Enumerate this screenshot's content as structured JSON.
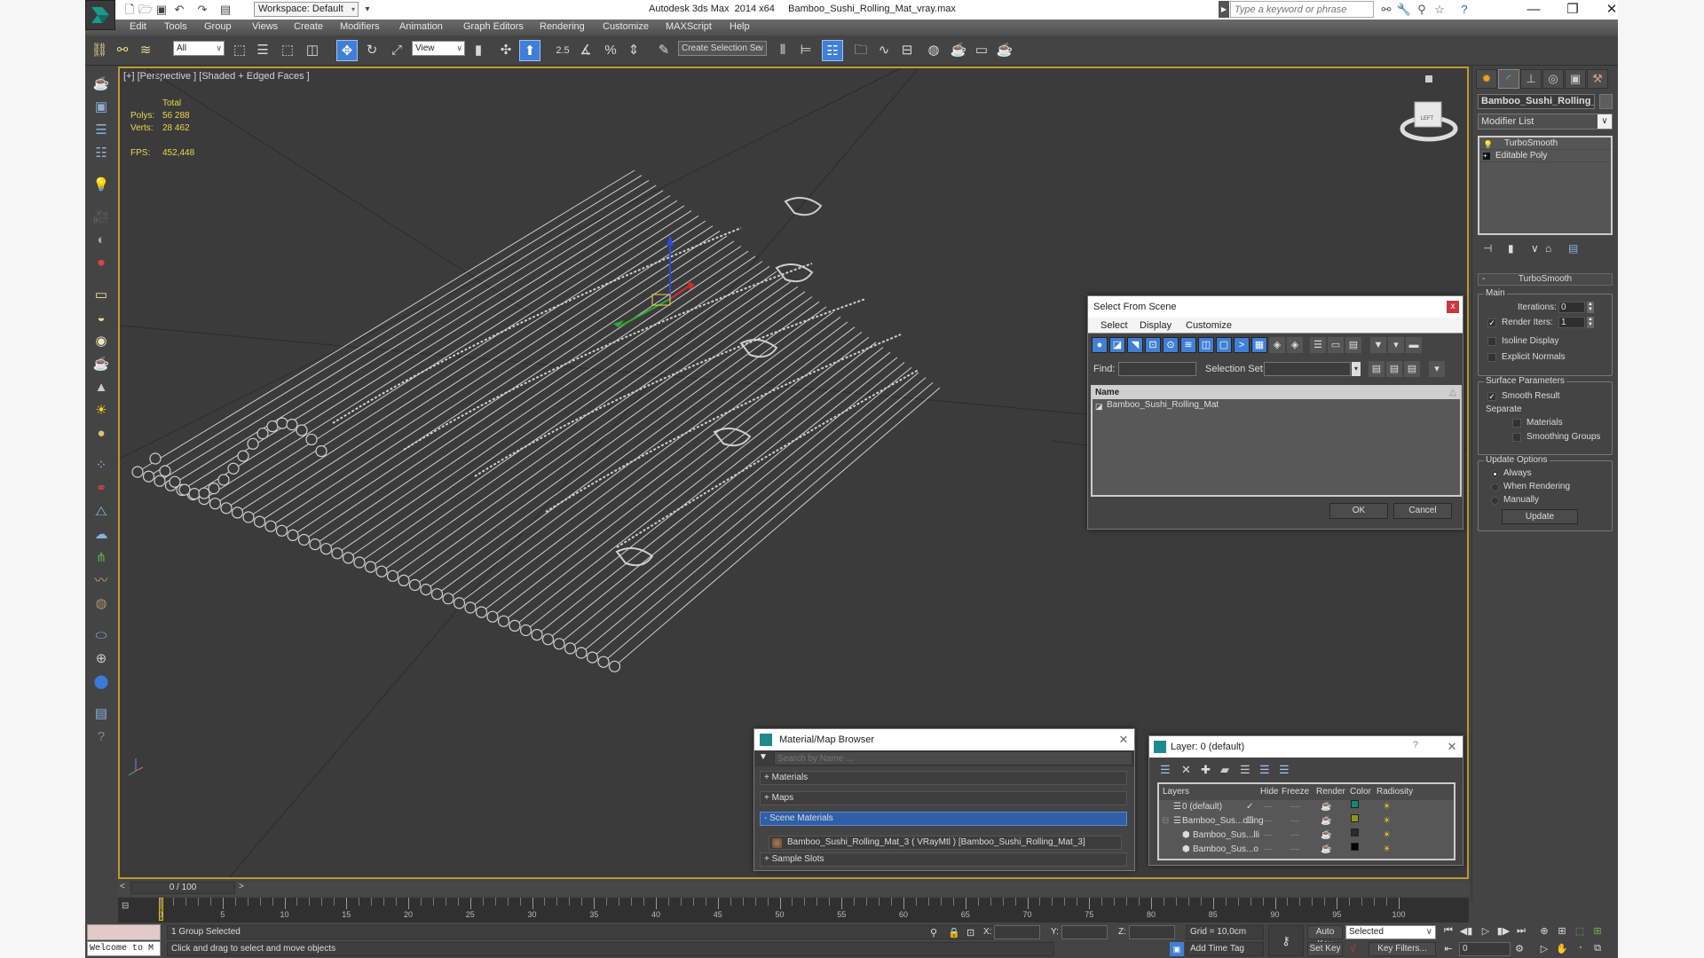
{
  "titlebar": {
    "workspace": "Workspace: Default",
    "title": "Autodesk 3ds Max  2014 x64     Bamboo_Sushi_Rolling_Mat_vray.max",
    "search_placeholder": "Type a keyword or phrase",
    "icons": [
      "binoculars-icon",
      "wrench-icon",
      "satellite-icon",
      "star-icon",
      "help-icon"
    ],
    "window_controls": {
      "minimize": "—",
      "restore": "❐",
      "close": "✕"
    }
  },
  "menu": [
    "Edit",
    "Tools",
    "Group",
    "Views",
    "Create",
    "Modifiers",
    "Animation",
    "Graph Editors",
    "Rendering",
    "Customize",
    "MAXScript",
    "Help"
  ],
  "toolbar": {
    "selection_filter": "All",
    "ref_coord": "View",
    "snap_label": "2.5",
    "named_selection_placeholder": "Create Selection Se"
  },
  "viewport": {
    "label": "[+] [Perspective ] [Shaded + Edged Faces ]",
    "stats": {
      "header": "Total",
      "polys_label": "Polys:",
      "polys": "56 288",
      "verts_label": "Verts:",
      "verts": "28 462",
      "fps_label": "FPS:",
      "fps": "452,448"
    },
    "viewcube_label": "LEFT"
  },
  "command_panel": {
    "object_name": "Bamboo_Sushi_Rolling_Mat",
    "modifier_list": "Modifier List",
    "stack": [
      {
        "name": "TurboSmooth",
        "icon": "lightbulb-icon"
      },
      {
        "name": "Editable Poly",
        "icon": "expand-icon"
      }
    ],
    "rollout": {
      "title": "TurboSmooth",
      "main_group": "Main",
      "iterations_label": "Iterations:",
      "iterations": "0",
      "render_iters_label": "Render Iters:",
      "render_iters": "1",
      "render_iters_checked": true,
      "isoline_display": "Isoline Display",
      "explicit_normals": "Explicit Normals",
      "surface_group": "Surface Parameters",
      "smooth_result": "Smooth Result",
      "separate": "Separate",
      "materials": "Materials",
      "smoothing_groups": "Smoothing Groups",
      "update_group": "Update Options",
      "always": "Always",
      "when_rendering": "When Rendering",
      "manually": "Manually",
      "update_button": "Update"
    }
  },
  "select_from_scene": {
    "title": "Select From Scene",
    "close": "x",
    "menu": [
      "Select",
      "Display",
      "Customize"
    ],
    "find_label": "Find:",
    "selection_set_label": "Selection Set:",
    "column_name": "Name",
    "rows": [
      "Bamboo_Sushi_Rolling_Mat"
    ],
    "ok": "OK",
    "cancel": "Cancel"
  },
  "material_browser": {
    "title": "Material/Map Browser",
    "search_placeholder": "Search by Name ...",
    "sections": [
      "+ Materials",
      "+ Maps",
      "- Scene Materials",
      "+ Sample Slots"
    ],
    "scene_material": "Bamboo_Sushi_Rolling_Mat_3 ( VRayMtl ) [Bamboo_Sushi_Rolling_Mat_3]"
  },
  "layer_manager": {
    "title": "Layer: 0 (default)",
    "help": "?",
    "columns": [
      "Layers",
      "Hide",
      "Freeze",
      "Render",
      "Color",
      "Radiosity"
    ],
    "rows": [
      {
        "name": "0 (default)",
        "current": "✓",
        "color": "#0f8a7a"
      },
      {
        "name": "Bamboo_Sus...olling",
        "current": "☐",
        "color": "#8a9a10"
      },
      {
        "name": "Bamboo_Sus...lli",
        "current": "",
        "color": "#2a2a2a"
      },
      {
        "name": "Bamboo_Sus...o",
        "current": "",
        "color": "#050505"
      }
    ]
  },
  "timeline": {
    "frame_display": "0 / 100",
    "current_frame": 0,
    "range": [
      0,
      100
    ],
    "labels": [
      "0",
      "5",
      "10",
      "15",
      "20",
      "25",
      "30",
      "35",
      "40",
      "45",
      "50",
      "55",
      "60",
      "65",
      "70",
      "75",
      "80",
      "85",
      "90",
      "95",
      "100"
    ]
  },
  "status": {
    "maxscript": "Welcome to M",
    "selection": "1 Group Selected",
    "prompt": "Click and drag to select and move objects",
    "x_label": "X:",
    "y_label": "Y:",
    "z_label": "Z:",
    "grid": "Grid = 10,0cm",
    "add_time_tag": "Add Time Tag",
    "auto_key": "Auto Key",
    "set_key": "Set Key",
    "key_mode": "Selected",
    "key_filters": "Key Filters...",
    "frame": "0"
  },
  "colors": {
    "accent": "#3f7fd6",
    "viewport_border": "#b89b2b",
    "stats_text": "#e8d84a",
    "wire": "#cfcfcf"
  }
}
